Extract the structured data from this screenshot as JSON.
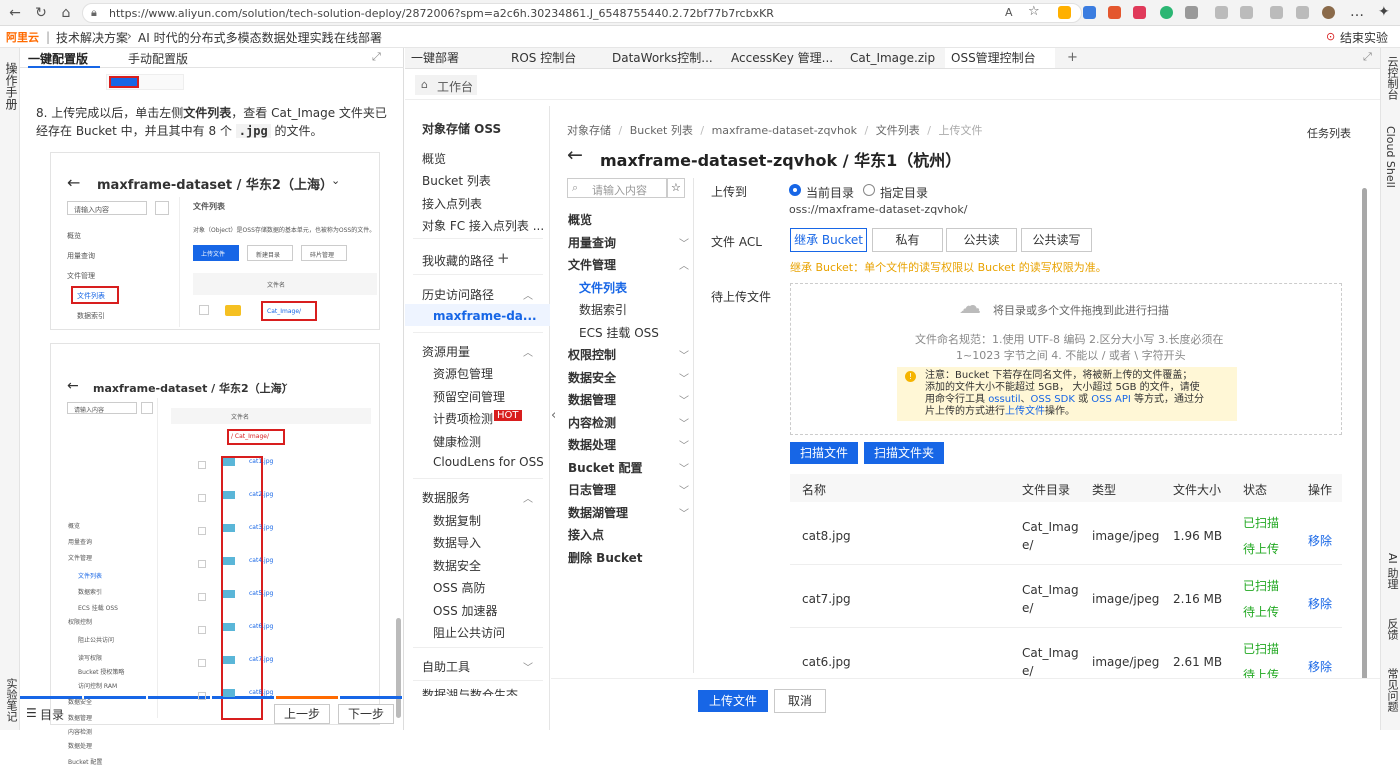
{
  "browser": {
    "url": "https://www.aliyun.com/solution/tech-solution-deploy/2872006?spm=a2c6h.30234861.J_6548755440.2.72bf77b7rcbxKR",
    "url_prefix_icon": "lock-icon",
    "controls": [
      "back-icon",
      "refresh-icon",
      "home-icon"
    ],
    "more": "…"
  },
  "breadcrumb": {
    "logo": "阿里云",
    "items": [
      "技术解决方案",
      "AI 时代的分布式多模态数据处理实践",
      "在线部署"
    ],
    "end_button": "结束实验"
  },
  "left_rail": {
    "top": "操作手册",
    "bottom": "实验笔记"
  },
  "tutorial": {
    "tabs": [
      "一键配置版",
      "手动配置版"
    ],
    "step_text_1": "8. 上传完成以后，单击左侧",
    "step_bold": "文件列表",
    "step_text_2": "，查看 Cat_Image 文件夹已经存在 Bucket 中，并且其中有 8 个",
    "step_code": ".jpg",
    "step_text_3": "的文件。",
    "thumb1": {
      "title": "maxframe-dataset / 华东2（上海）",
      "search": "请输入内容",
      "menu": [
        "概览",
        "用量查询",
        "文件管理",
        "文件列表",
        "数据索引"
      ],
      "header": "文件列表",
      "desc": "对象（Object）是OSS存储数据的基本单元，也被称为OSS的文件。",
      "buttons": [
        "上传文件",
        "新建目录",
        "碎片管理"
      ],
      "col": "文件名",
      "folder": "Cat_Image/"
    },
    "thumb2": {
      "title": "maxframe-dataset / 华东2（上海）",
      "search": "请输入内容",
      "menu": [
        "概览",
        "用量查询",
        "文件管理",
        "文件列表",
        "数据索引",
        "ECS 挂载 OSS",
        "权限控制",
        "阻止公共访问",
        "读写权限",
        "Bucket 授权策略",
        "访问控制 RAM",
        "数据安全",
        "数据管理",
        "内容检测",
        "数据处理",
        "Bucket 配置"
      ],
      "col": "文件名",
      "path": "/ Cat_Image/",
      "files": [
        "cat1.jpg",
        "cat2.jpg",
        "cat3.jpg",
        "cat4.jpg",
        "cat5.jpg",
        "cat6.jpg",
        "cat7.jpg",
        "cat8.jpg"
      ]
    },
    "toc": "目录",
    "prev": "上一步",
    "next": "下一步"
  },
  "console": {
    "tabs": [
      "一键部署",
      "ROS 控制台",
      "DataWorks控制...",
      "AccessKey 管理...",
      "Cat_Image.zip",
      "OSS管理控制台"
    ],
    "add_tab": "+",
    "workbench": "工作台",
    "oss_title": "对象存储 OSS",
    "main_nav": {
      "top": [
        "概览",
        "Bucket 列表",
        "接入点列表",
        "对象 FC 接入点列表 ..."
      ],
      "fav": "我收藏的路径",
      "history": "历史访问路径",
      "history_item": "maxframe-da...",
      "resource": "资源用量",
      "resource_items": [
        "资源包管理",
        "预留空间管理",
        "计费项检测",
        "健康检测",
        "CloudLens for OSS"
      ],
      "hot": "HOT",
      "data_service": "数据服务",
      "data_items": [
        "数据复制",
        "数据导入",
        "数据安全",
        "OSS 高防",
        "OSS 加速器",
        "阻止公共访问"
      ],
      "self_tool": "自助工具",
      "cutoff": "数据湖与数仓生态"
    },
    "path_crumb": [
      "对象存储",
      "Bucket 列表",
      "maxframe-dataset-zqvhok",
      "文件列表",
      "上传文件"
    ],
    "task_list": "任务列表",
    "title": "maxframe-dataset-zqvhok / 华东1（杭州）",
    "sub_nav": {
      "search": "请输入内容",
      "items": [
        "概览",
        "用量查询",
        "文件管理",
        "文件列表",
        "数据索引",
        "ECS 挂载 OSS",
        "权限控制",
        "数据安全",
        "数据管理",
        "内容检测",
        "数据处理",
        "Bucket 配置",
        "日志管理",
        "数据湖管理",
        "接入点",
        "删除 Bucket"
      ]
    },
    "upload_to_label": "上传到",
    "radio_current": "当前目录",
    "radio_specified": "指定目录",
    "upload_path": "oss://maxframe-dataset-zqvhok/",
    "acl_label": "文件 ACL",
    "acl_options": [
      "继承 Bucket",
      "私有",
      "公共读",
      "公共读写"
    ],
    "acl_note": "继承 Bucket：单个文件的读写权限以 Bucket 的读写权限为准。",
    "pending_label": "待上传文件",
    "drop_text": "将目录或多个文件拖拽到此进行扫描",
    "rule_text_1": "文件命名规范：1.使用 UTF-8 编码 2.区分大小写 3.长度必须在",
    "rule_text_2": "1~1023 字节之间 4. 不能以 / 或者 \\ 字符开头",
    "warn_1": "注意：Bucket 下若存在同名文件，将被新上传的文件覆盖；",
    "warn_2": "添加的文件大小不能超过 5GB， 大小超过 5GB 的文件，请使",
    "warn_3a": "用命令行工具",
    "warn_link1": "ossutil",
    "warn_sep1": "、",
    "warn_link2": "OSS SDK",
    "warn_or": "或",
    "warn_link3": "OSS API",
    "warn_3b": "等方式，通过分",
    "warn_4a": "片上传的方式进行",
    "warn_link4": "上传文件",
    "warn_4b": "操作。",
    "scan_file": "扫描文件",
    "scan_folder": "扫描文件夹",
    "table_headers": [
      "名称",
      "文件目录",
      "类型",
      "文件大小",
      "状态",
      "操作"
    ],
    "rows": [
      {
        "name": "cat8.jpg",
        "dir1": "Cat_Imag",
        "dir2": "e/",
        "type": "image/jpeg",
        "size": "1.96 MB",
        "s1": "已扫描",
        "s2": "待上传",
        "op": "移除"
      },
      {
        "name": "cat7.jpg",
        "dir1": "Cat_Imag",
        "dir2": "e/",
        "type": "image/jpeg",
        "size": "2.16 MB",
        "s1": "已扫描",
        "s2": "待上传",
        "op": "移除"
      },
      {
        "name": "cat6.jpg",
        "dir1": "Cat_Imag",
        "dir2": "e/",
        "type": "image/jpeg",
        "size": "2.61 MB",
        "s1": "已扫描",
        "s2": "待上传",
        "op": "移除"
      }
    ],
    "upload_btn": "上传文件",
    "cancel_btn": "取消"
  },
  "right_rail": [
    "云控制台",
    "Cloud Shell",
    "AI 助理",
    "反馈",
    "常见问题"
  ],
  "colors": {
    "accent": "#1766e6",
    "orange": "#ff6a00",
    "warn_bg": "#fff7d6",
    "warn_text": "#e8a200",
    "hot": "#d81e1e"
  }
}
